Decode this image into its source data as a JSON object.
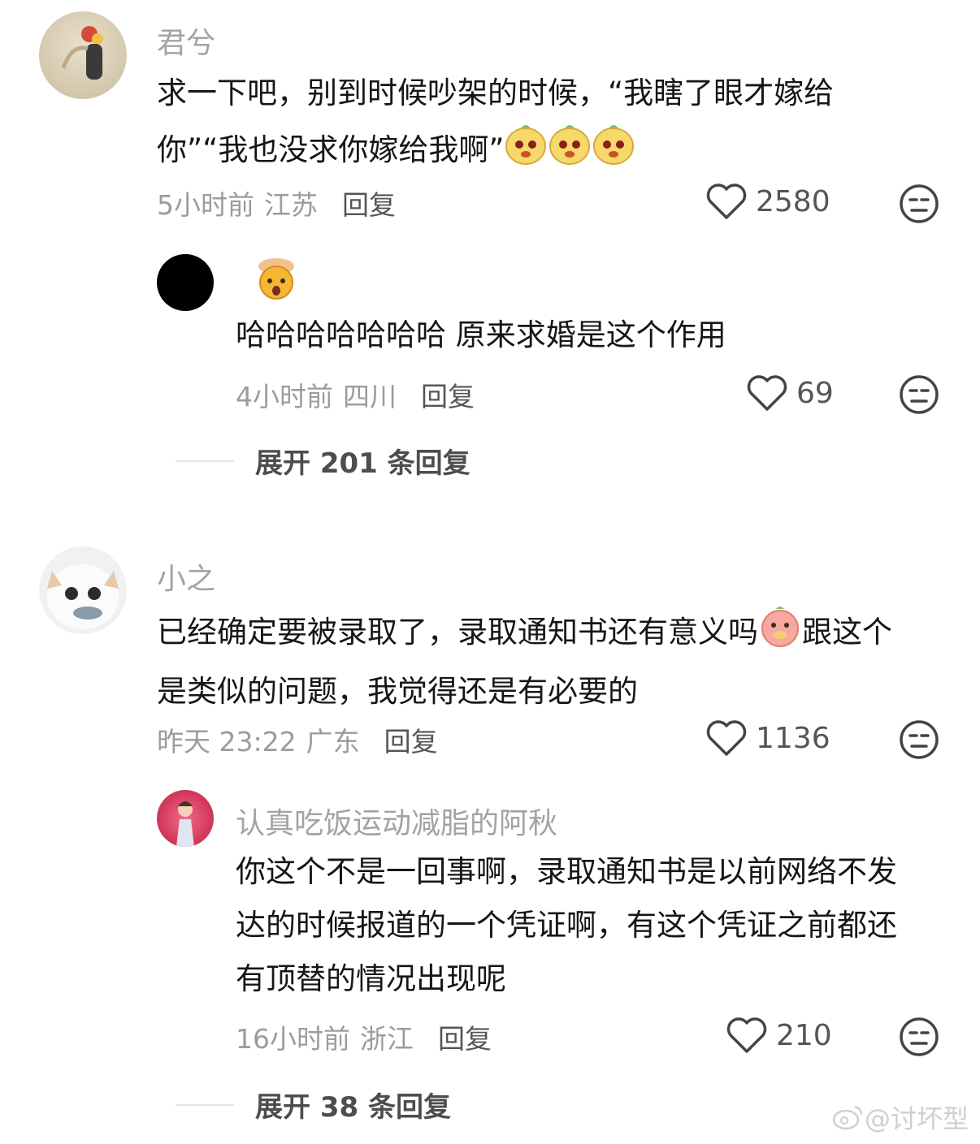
{
  "comments": [
    {
      "username": "君兮",
      "text": "求一下吧，别到时候吵架的时候，“我瞎了眼才嫁给你”“我也没求你嫁给我啊”",
      "time": "5小时前",
      "location": "江苏",
      "reply_label": "回复",
      "likes": "2580",
      "sub": {
        "username": "",
        "text": "哈哈哈哈哈哈哈  原来求婚是这个作用",
        "time": "4小时前",
        "location": "四川",
        "reply_label": "回复",
        "likes": "69"
      },
      "expand_label": "展开 201 条回复"
    },
    {
      "username": "小之",
      "text": "已经确定要被录取了，录取通知书还有意义吗",
      "text2": "跟这个是类似的问题，我觉得还是有必要的",
      "time": "昨天 23:22",
      "location": "广东",
      "reply_label": "回复",
      "likes": "1136",
      "sub": {
        "username": "认真吃饭运动减脂的阿秋",
        "text": "你这个不是一回事啊，录取通知书是以前网络不发达的时候报道的一个凭证啊，有这个凭证之前都还有顶替的情况出现呢",
        "time": "16小时前",
        "location": "浙江",
        "reply_label": "回复",
        "likes": "210"
      },
      "expand_label": "展开 38 条回复"
    }
  ],
  "watermark": "@讨坏型",
  "colors": {
    "accent": "#161616",
    "meta": "#9c9c9c",
    "name": "#a3a3a3"
  }
}
